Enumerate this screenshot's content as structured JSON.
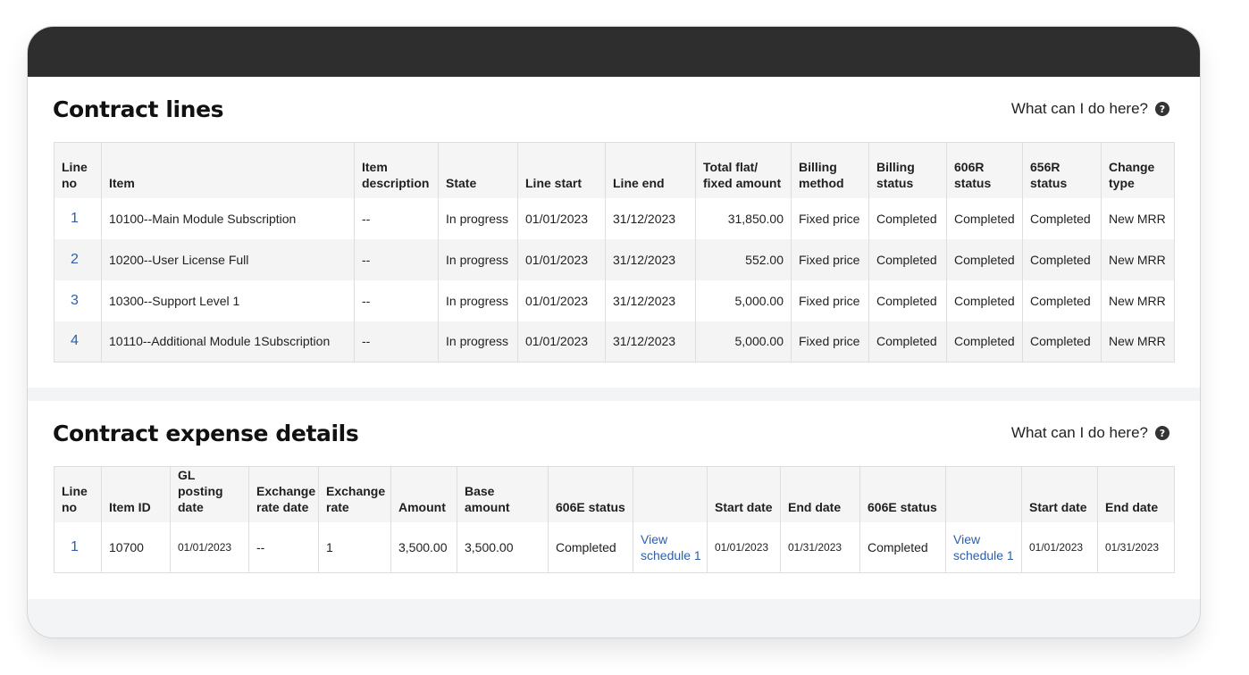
{
  "contract_lines": {
    "title": "Contract lines",
    "help_label": "What can I do here?",
    "columns": [
      "Line no",
      "Item",
      "Item description",
      "State",
      "Line start",
      "Line end",
      "Total flat/ fixed amount",
      "Billing method",
      "Billing status",
      "606R status",
      "656R status",
      "Change type"
    ],
    "rows": [
      {
        "line": "1",
        "item": "10100--Main Module Subscription",
        "desc": "--",
        "state": "In progress",
        "start": "01/01/2023",
        "end": "31/12/2023",
        "amount": "31,850.00",
        "method": "Fixed price",
        "billing_status": "Completed",
        "s606r": "Completed",
        "s656r": "Completed",
        "change": "New MRR"
      },
      {
        "line": "2",
        "item": "10200--User License Full",
        "desc": "--",
        "state": "In progress",
        "start": "01/01/2023",
        "end": "31/12/2023",
        "amount": "552.00",
        "method": "Fixed price",
        "billing_status": "Completed",
        "s606r": "Completed",
        "s656r": "Completed",
        "change": "New MRR"
      },
      {
        "line": "3",
        "item": "10300--Support Level 1",
        "desc": "--",
        "state": "In progress",
        "start": "01/01/2023",
        "end": "31/12/2023",
        "amount": "5,000.00",
        "method": "Fixed price",
        "billing_status": "Completed",
        "s606r": "Completed",
        "s656r": "Completed",
        "change": "New MRR"
      },
      {
        "line": "4",
        "item": "10110--Additional Module 1Subscription",
        "desc": "--",
        "state": "In progress",
        "start": "01/01/2023",
        "end": "31/12/2023",
        "amount": "5,000.00",
        "method": "Fixed price",
        "billing_status": "Completed",
        "s606r": "Completed",
        "s656r": "Completed",
        "change": "New MRR"
      }
    ]
  },
  "expense_details": {
    "title": "Contract expense details",
    "help_label": "What can I do here?",
    "columns": [
      "Line no",
      "Item ID",
      "GL posting date",
      "Exchange rate date",
      "Exchange rate",
      "Amount",
      "Base amount",
      "606E status",
      "",
      "Start date",
      "End date",
      "606E status",
      "",
      "Start date",
      "End date"
    ],
    "rows": [
      {
        "line": "1",
        "item_id": "10700",
        "gl_date": "01/01/2023",
        "rate_date": "--",
        "rate": "1",
        "amount": "3,500.00",
        "base_amount": "3,500.00",
        "status_a": "Completed",
        "schedule_a": "View schedule 1",
        "start_a": "01/01/2023",
        "end_a": "01/31/2023",
        "status_b": "Completed",
        "schedule_b": "View schedule 1",
        "start_b": "01/01/2023",
        "end_b": "01/31/2023"
      }
    ]
  }
}
